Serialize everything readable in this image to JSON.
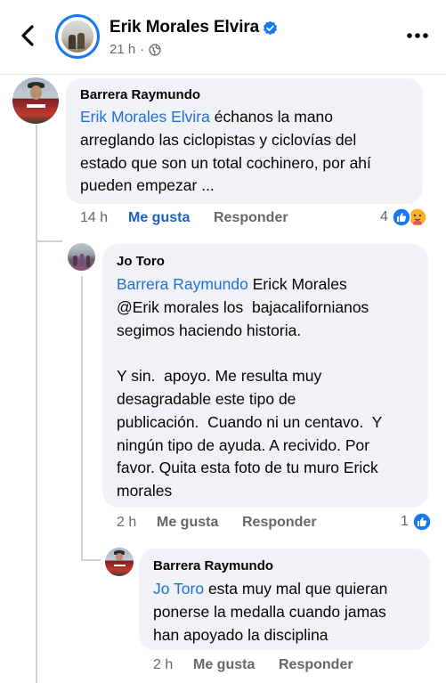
{
  "header": {
    "page_name": "Erik Morales Elvira",
    "time": "21 h",
    "separator": "·",
    "icons": {
      "back": "chevron-left-icon",
      "verified": "verified-badge-icon",
      "privacy": "globe-icon",
      "more": "more-horizontal-icon"
    },
    "accent": "#1877f2"
  },
  "comments": [
    {
      "author": "Barrera Raymundo",
      "mention": "Erik Morales Elvira",
      "lines": [
        " échanos la mano",
        "arreglando las ciclopistas y ciclovías del",
        "estado que son un total cochinero, por ahí",
        "pueden empezar ..."
      ],
      "time": "14 h",
      "like_label": "Me gusta",
      "reply_label": "Responder",
      "reactions": {
        "count": "4",
        "types": [
          "like-icon",
          "care-icon"
        ]
      }
    },
    {
      "author": "Jo Toro",
      "mention": "Barrera Raymundo",
      "lines": [
        " Erick Morales",
        "@Erik morales los  bajacalifornianos",
        "segimos haciendo historia.",
        "",
        "Y sin.  apoyo. Me resulta muy",
        "desagradable este tipo de",
        "publicación.  Cuando ni un centavo.  Y",
        "ningún tipo de ayuda. A recivido. Por",
        "favor. Quita esta foto de tu muro Erick",
        "morales"
      ],
      "time": "2 h",
      "like_label": "Me gusta",
      "reply_label": "Responder",
      "reactions": {
        "count": "1",
        "types": [
          "like-icon"
        ]
      }
    },
    {
      "author": "Barrera Raymundo",
      "mention": "Jo Toro",
      "lines": [
        " esta muy mal que quieran",
        "ponerse la medalla cuando jamas",
        "han apoyado la disciplina"
      ],
      "time": "2 h",
      "like_label": "Me gusta",
      "reply_label": "Responder"
    }
  ],
  "colors": {
    "mention": "#216fdb",
    "like_active": "#1b61c9",
    "bubble": "#f0f2f5",
    "muted": "#65676b"
  }
}
